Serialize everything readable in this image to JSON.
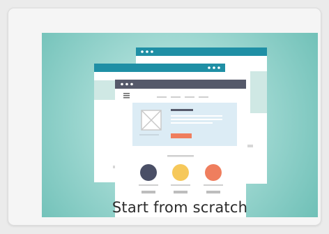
{
  "template_card": {
    "caption": "Start from scratch",
    "icon": "website-wireframe-illustration",
    "colors": {
      "thumbnail_bg": "#8ccfc6",
      "window_header_teal": "#1f8fa5",
      "window_header_dark": "#55596a",
      "hero_block": "#dcecf5",
      "accent_orange": "#ef7e5e",
      "circle_navy": "#4a4f66",
      "circle_yellow": "#f6c85a",
      "circle_coral": "#ef7e5e"
    }
  }
}
